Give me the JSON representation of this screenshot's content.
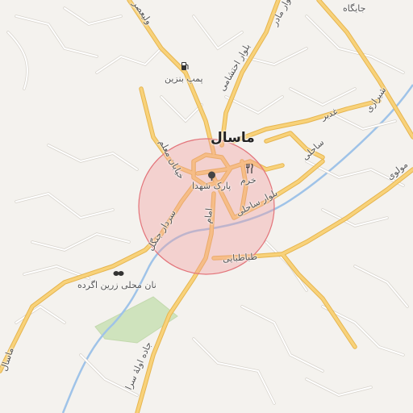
{
  "map": {
    "city_name": "ماسال",
    "colors": {
      "background": "#f4f2ee",
      "main_road": "#f7cf6f",
      "main_road_casing": "#e8b04e",
      "minor_road": "#ffffff",
      "minor_road_casing": "#d9d6d0",
      "river": "#9fc3e8",
      "park": "#cfe3bd",
      "highlight_circle": "#f29a9e"
    },
    "labels": {
      "city": "ماسال",
      "park": "پارک شهدا",
      "gas_station": "پمپ بنزین",
      "station": "جایگاه",
      "khorram": "خرم",
      "bakery": "نان محلی زرین اگرده",
      "blvd_madar": "بلوار مادر",
      "blvd_ehteshami": "بلوار احتشامی",
      "shirazi": "شیرازی",
      "ghadir": "غدیر",
      "sahili": "ساحلی",
      "blvd_sahili": "بلوار ساحلی",
      "molavi": "مولوی",
      "khiaban_moallem": "خیابان معلم",
      "sardar_jangal": "سردار جنگل",
      "imam": "امام",
      "tabatabaei": "طباطبایی",
      "jadeh_ouleh_sara": "جاده اولهٔ سرا",
      "masal_rd": "ماسال",
      "valiasr": "ولیعصر"
    },
    "icons": {
      "gas": "fuel-pump-icon",
      "park": "tree-icon",
      "restaurant": "fork-knife-icon",
      "bakery": "bakery-icon"
    }
  }
}
